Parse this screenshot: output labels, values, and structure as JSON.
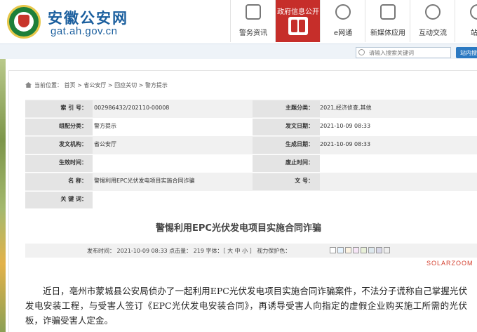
{
  "header": {
    "site_title": "安徽公安网",
    "site_domain": "gat.ah.gov.cn"
  },
  "nav": [
    {
      "label": "警务资讯",
      "icon": "news-icon"
    },
    {
      "label": "政府信息公开",
      "icon": "folder-icon",
      "active": true
    },
    {
      "label": "e网通",
      "icon": "e-icon"
    },
    {
      "label": "新媒体应用",
      "icon": "media-icon"
    },
    {
      "label": "互动交流",
      "icon": "chat-icon"
    },
    {
      "label": "站群",
      "icon": "site-icon"
    }
  ],
  "search": {
    "placeholder": "请输入搜索关键词",
    "button_label": "站内搜"
  },
  "breadcrumb": "当前位置： 首页 > 省公安厅 > 回应关切 > 警方提示",
  "meta": {
    "index_label": "索 引 号：",
    "index_value": "002986432/202110-00008",
    "topic_label": "主题分类：",
    "topic_value": "2021,经济侦查,其他",
    "org_label": "组配分类：",
    "org_value": "警方提示",
    "pubdate_label": "发文日期：",
    "pubdate_value": "2021-10-09 08:33",
    "issuer_label": "发文机构：",
    "issuer_value": "省公安厅",
    "created_label": "生成日期：",
    "created_value": "2021-10-09 08:33",
    "effective_label": "生效时间：",
    "effective_value": "",
    "repeal_label": "废止时间：",
    "repeal_value": "",
    "name_label": "名 称：",
    "name_value": "警惕利用EPC光伏发电项目实施合同诈骗",
    "docno_label": "文 号：",
    "docno_value": "",
    "keywords_label": "关 键 词：",
    "keywords_value": ""
  },
  "article": {
    "title": "警惕利用EPC光伏发电项目实施合同诈骗",
    "info": "发布时间： 2021-10-09 08:33    点击量： 219    字体：［ 大 中 小 ］   视力保护色：",
    "swatch_colors": [
      "#ffffff",
      "#e6f4ff",
      "#fdf4e3",
      "#f6e5f6",
      "#e8f0d8",
      "#dde8ee",
      "#d8d8e8",
      "#eeeeee"
    ],
    "body": "近日，亳州市蒙城县公安局侦办了一起利用EPC光伏发电项目实施合同诈骗案件，不法分子谎称自己掌握光伏发电安装工程，与受害人签订《EPC光伏发电安装合同》，再诱导受害人向指定的虚假企业购买施工所需的光伏板，诈骗受害人定金。"
  },
  "watermark": "SOLARZOOM"
}
